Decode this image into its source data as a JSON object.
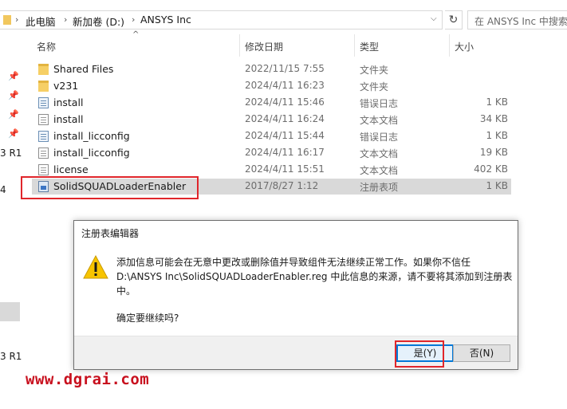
{
  "breadcrumb": [
    "此电脑",
    "新加卷 (D:)",
    "ANSYS Inc"
  ],
  "search": {
    "placeholder": "在 ANSYS Inc 中搜索"
  },
  "nav_fragments": [
    "3 R1",
    "4",
    "3 R1"
  ],
  "columns": {
    "name": "名称",
    "date": "修改日期",
    "type": "类型",
    "size": "大小"
  },
  "files": [
    {
      "name": "Shared Files",
      "date": "2022/11/15 7:55",
      "type": "文件夹",
      "size": "",
      "icon": "folder-icon"
    },
    {
      "name": "v231",
      "date": "2024/4/11 16:23",
      "type": "文件夹",
      "size": "",
      "icon": "folder-icon"
    },
    {
      "name": "install",
      "date": "2024/4/11 15:46",
      "type": "错误日志",
      "size": "1 KB",
      "icon": "log-file-icon"
    },
    {
      "name": "install",
      "date": "2024/4/11 16:24",
      "type": "文本文档",
      "size": "34 KB",
      "icon": "text-file-icon"
    },
    {
      "name": "install_licconfig",
      "date": "2024/4/11 15:44",
      "type": "错误日志",
      "size": "1 KB",
      "icon": "log-file-icon"
    },
    {
      "name": "install_licconfig",
      "date": "2024/4/11 16:17",
      "type": "文本文档",
      "size": "19 KB",
      "icon": "text-file-icon"
    },
    {
      "name": "license",
      "date": "2024/4/11 15:51",
      "type": "文本文档",
      "size": "402 KB",
      "icon": "text-file-icon"
    },
    {
      "name": "SolidSQUADLoaderEnabler",
      "date": "2017/8/27 1:12",
      "type": "注册表项",
      "size": "1 KB",
      "icon": "registry-file-icon"
    }
  ],
  "dialog": {
    "title": "注册表编辑器",
    "message_line1": "添加信息可能会在无意中更改或删除值并导致组件无法继续正常工作。如果你不信任",
    "message_line2": "D:\\ANSYS Inc\\SolidSQUADLoaderEnabler.reg 中此信息的来源，请不要将其添加到注册表",
    "message_line3": "中。",
    "confirm": "确定要继续吗?",
    "yes": "是(Y)",
    "no": "否(N)"
  },
  "watermark": "www.dgrai.com",
  "colors": {
    "highlight": "#e0262b",
    "selected_row": "#d9d9d9",
    "focus_blue": "#0078d7",
    "watermark": "#c8101e"
  }
}
